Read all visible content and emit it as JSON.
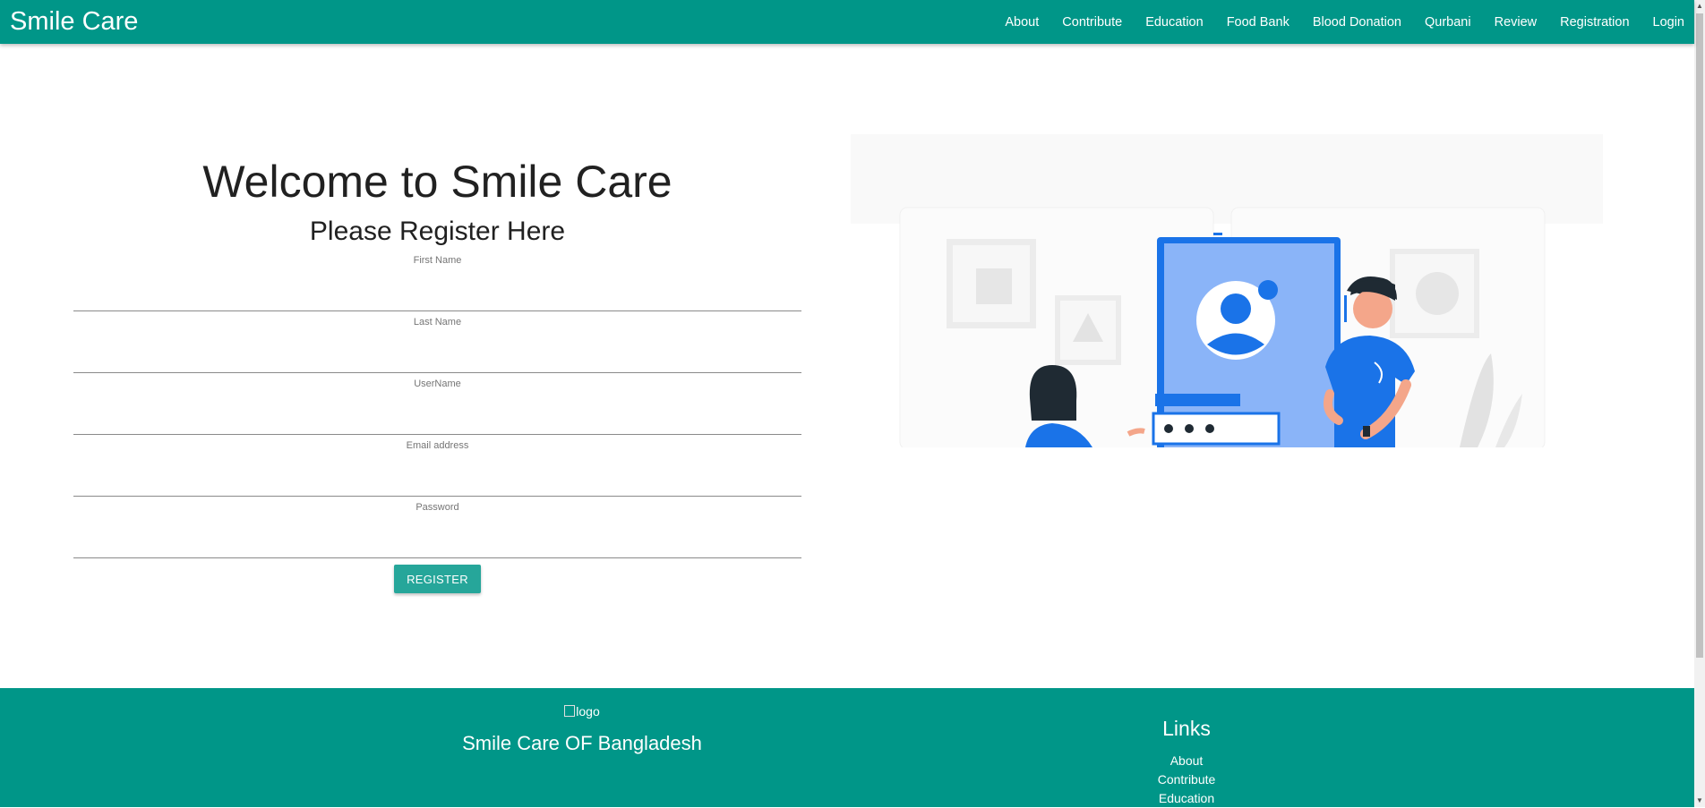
{
  "navbar": {
    "brand": "Smile Care",
    "links": [
      "About",
      "Contribute",
      "Education",
      "Food Bank",
      "Blood Donation",
      "Qurbani",
      "Review",
      "Registration",
      "Login"
    ]
  },
  "main": {
    "welcome": "Welcome to Smile Care",
    "subtitle": "Please Register Here",
    "fields": {
      "first_name": {
        "label": "First Name",
        "value": ""
      },
      "last_name": {
        "label": "Last Name",
        "value": ""
      },
      "username": {
        "label": "UserName",
        "value": ""
      },
      "email": {
        "label": "Email address",
        "value": ""
      },
      "password": {
        "label": "Password",
        "value": ""
      }
    },
    "register_button": "REGISTER"
  },
  "footer": {
    "logo_alt": "logo",
    "org_name": "Smile Care OF Bangladesh",
    "links_heading": "Links",
    "links": [
      "About",
      "Contribute",
      "Education"
    ]
  },
  "colors": {
    "primary": "#009688",
    "button": "#26a69a",
    "illustration_blue": "#1a73e8"
  }
}
